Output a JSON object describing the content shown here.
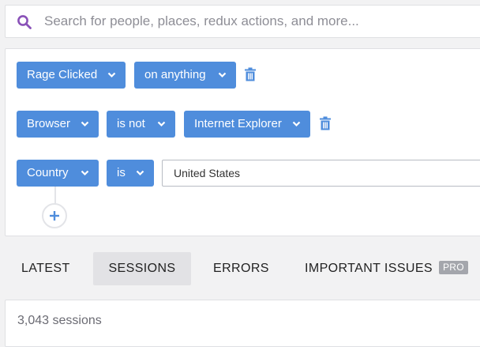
{
  "search": {
    "placeholder": "Search for people, places, redux actions, and more...",
    "value": ""
  },
  "filters": [
    {
      "field": "Rage Clicked",
      "operator": "on anything",
      "value": null,
      "deletable": true
    },
    {
      "field": "Browser",
      "operator": "is not",
      "value": "Internet Explorer",
      "deletable": true
    },
    {
      "field": "Country",
      "operator": "is",
      "value": "United States",
      "deletable": false
    }
  ],
  "tabs": [
    {
      "label": "LATEST",
      "active": false
    },
    {
      "label": "SESSIONS",
      "active": true
    },
    {
      "label": "ERRORS",
      "active": false
    },
    {
      "label": "IMPORTANT ISSUES",
      "active": false,
      "badge": "PRO"
    }
  ],
  "results": {
    "count_text": "3,043 sessions"
  },
  "icons": {
    "search": "search-icon",
    "chevron": "chevron-down-icon",
    "delete": "trash-icon",
    "add": "plus-icon"
  },
  "colors": {
    "accent": "#4f8ddc",
    "search_icon": "#8a52b8",
    "page_bg": "#f2f2f3",
    "active_tab_bg": "#e2e2e5",
    "badge_bg": "#a4a6ac"
  }
}
